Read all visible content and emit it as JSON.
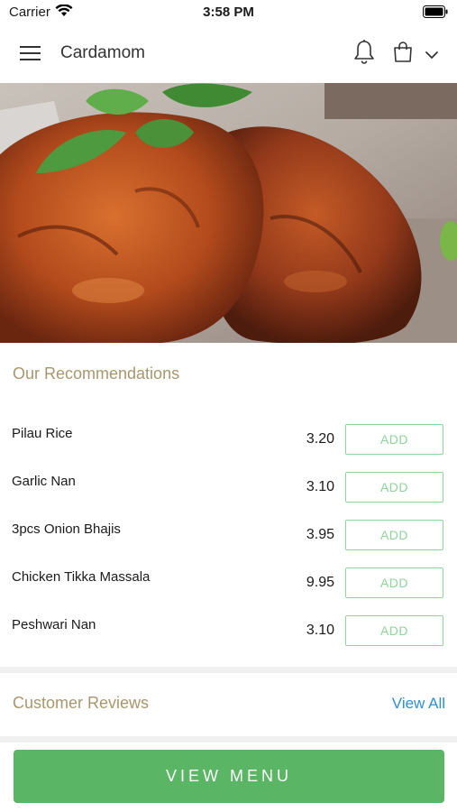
{
  "status_bar": {
    "carrier": "Carrier",
    "time": "3:58 PM"
  },
  "header": {
    "title": "Cardamom",
    "icons": [
      "menu-icon",
      "bell-icon",
      "shopping-bag-icon",
      "chevron-down-icon"
    ]
  },
  "recommendations": {
    "title": "Our Recommendations",
    "items": [
      {
        "name": "Pilau Rice",
        "price": "3.20",
        "action": "ADD"
      },
      {
        "name": "Garlic Nan",
        "price": "3.10",
        "action": "ADD"
      },
      {
        "name": "3pcs Onion Bhajis",
        "price": "3.95",
        "action": "ADD"
      },
      {
        "name": "Chicken Tikka Massala",
        "price": "9.95",
        "action": "ADD"
      },
      {
        "name": "Peshwari Nan",
        "price": "3.10",
        "action": "ADD"
      }
    ]
  },
  "reviews": {
    "title": "Customer Reviews",
    "view_all": "View All"
  },
  "footer": {
    "view_menu": "VIEW MENU"
  },
  "colors": {
    "accent_green": "#5ab565",
    "section_title": "#a8976e",
    "link_blue": "#2f8fd0"
  }
}
